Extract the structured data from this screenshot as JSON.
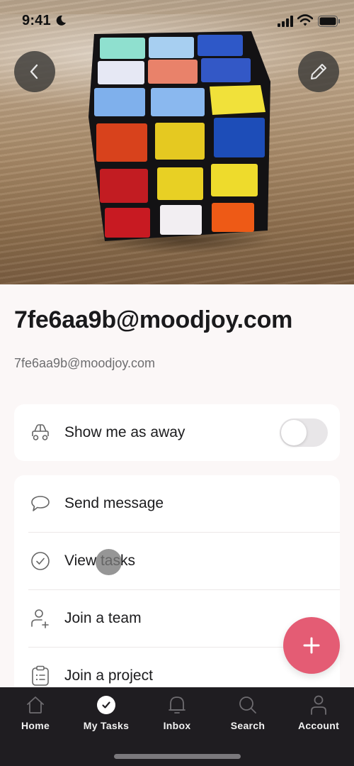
{
  "status_bar": {
    "time": "9:41",
    "focus_mode_icon": "moon-icon",
    "signal_icon": "cellular-signal-icon",
    "wifi_icon": "wifi-icon",
    "battery_icon": "battery-icon"
  },
  "header": {
    "back_icon": "chevron-left-icon",
    "edit_icon": "pencil-icon",
    "cover_photo": "rubiks-cube-photo"
  },
  "profile": {
    "name": "7fe6aa9b@moodjoy.com",
    "email": "7fe6aa9b@moodjoy.com"
  },
  "away_card": {
    "label": "Show me as away",
    "icon": "car-icon",
    "toggle_on": false
  },
  "actions": [
    {
      "label": "Send message",
      "icon": "speech-bubble-icon"
    },
    {
      "label": "View tasks",
      "icon": "check-circle-icon"
    },
    {
      "label": "Join a team",
      "icon": "add-person-icon"
    },
    {
      "label": "Join a project",
      "icon": "clipboard-list-icon"
    }
  ],
  "fab": {
    "icon": "plus-icon",
    "color": "#e45c74"
  },
  "tabbar": {
    "items": [
      {
        "label": "Home",
        "icon": "home-icon",
        "active": false
      },
      {
        "label": "My Tasks",
        "icon": "check-circle-filled-icon",
        "active": true
      },
      {
        "label": "Inbox",
        "icon": "bell-icon",
        "active": false
      },
      {
        "label": "Search",
        "icon": "search-icon",
        "active": false
      },
      {
        "label": "Account",
        "icon": "person-icon",
        "active": false
      }
    ]
  },
  "colors": {
    "background": "#fbf7f7",
    "card": "#ffffff",
    "tabbar": "#1f1d21",
    "accent": "#e45c74"
  }
}
